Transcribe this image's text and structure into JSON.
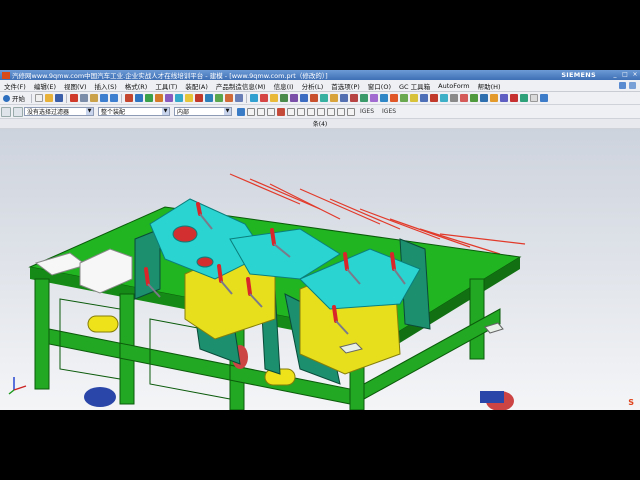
{
  "window": {
    "title": "汽修网www.9qmw.com中国汽车工业.企业实战人才在线培训平台 - 建模 - [www.9qmw.com.prt（修改的）]",
    "brand": "SIEMENS",
    "controls": [
      "_",
      "□",
      "×"
    ]
  },
  "menu": {
    "items": [
      "文件(F)",
      "编辑(E)",
      "视图(V)",
      "插入(S)",
      "格式(R)",
      "工具(T)",
      "装配(A)",
      "产品制造信息(M)",
      "信息(I)",
      "分析(L)",
      "首选项(P)",
      "窗口(O)",
      "GC 工具箱",
      "AutoForm",
      "帮助(H)"
    ]
  },
  "toolbar": {
    "start_label": "开始",
    "filter_select": "没有选择过滤器",
    "scope_select": "整个装配",
    "location_select": "内部",
    "iges_labels": [
      "IGES",
      "IGES"
    ]
  },
  "view": {
    "name": "条(4)"
  },
  "colors": {
    "base_plate": "#1fb31f",
    "frame": "#1fa51f",
    "fixture_dark": "#1b8a6a",
    "clamp_red": "#d8262b",
    "part_cyan": "#27d7d4",
    "part_yellow": "#e9e21a",
    "titlebar": "#3f6fb5"
  },
  "icons": [
    "app-icon",
    "start-gear-icon",
    "new-file-icon",
    "open-icon",
    "save-icon",
    "undo-icon",
    "redo-icon",
    "cut-icon",
    "copy-icon",
    "paste-icon",
    "fit-view-icon",
    "zoom-icon",
    "rotate-icon",
    "pan-icon",
    "shaded-icon",
    "wireframe-icon",
    "snap-point-icon",
    "help-icon",
    "coordinate-triad-icon"
  ]
}
